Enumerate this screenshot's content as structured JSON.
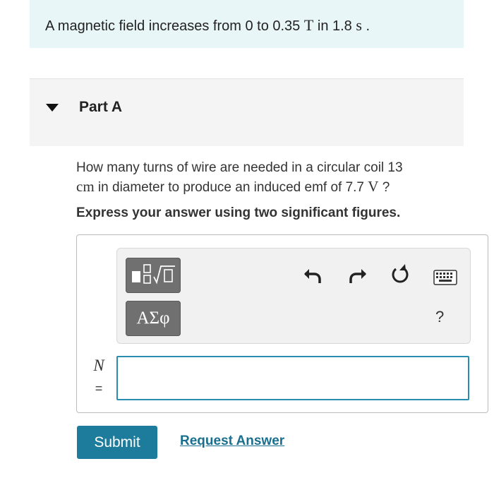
{
  "intro": {
    "prefix": "A magnetic field increases from 0 to 0.35 ",
    "unit_T": "T",
    "middle": " in 1.8 ",
    "unit_s": "s",
    "suffix": " ."
  },
  "part": {
    "title": "Part A"
  },
  "question": {
    "line1": "How many turns of wire are needed in a circular coil 13",
    "unit_cm": "cm",
    "line2_text": " in diameter to produce an induced emf of 7.7 ",
    "unit_V": "V",
    "line2_end": " ?"
  },
  "instruction": "Express your answer using two significant figures.",
  "toolbar": {
    "greek_label": "ΑΣφ",
    "help_label": "?",
    "icons": [
      "templates-icon",
      "greek-letters",
      "undo-icon",
      "redo-icon",
      "reset-icon",
      "keyboard-icon",
      "help-icon"
    ]
  },
  "answer": {
    "variable": "N",
    "equals": "=",
    "value": ""
  },
  "actions": {
    "submit_label": "Submit",
    "request_label": "Request Answer"
  },
  "colors": {
    "intro_bg": "#e8f6f8",
    "part_bg": "#f4f4f4",
    "submit_bg": "#1d7c9b",
    "link": "#1a6f8e",
    "input_border": "#2a8db0"
  }
}
